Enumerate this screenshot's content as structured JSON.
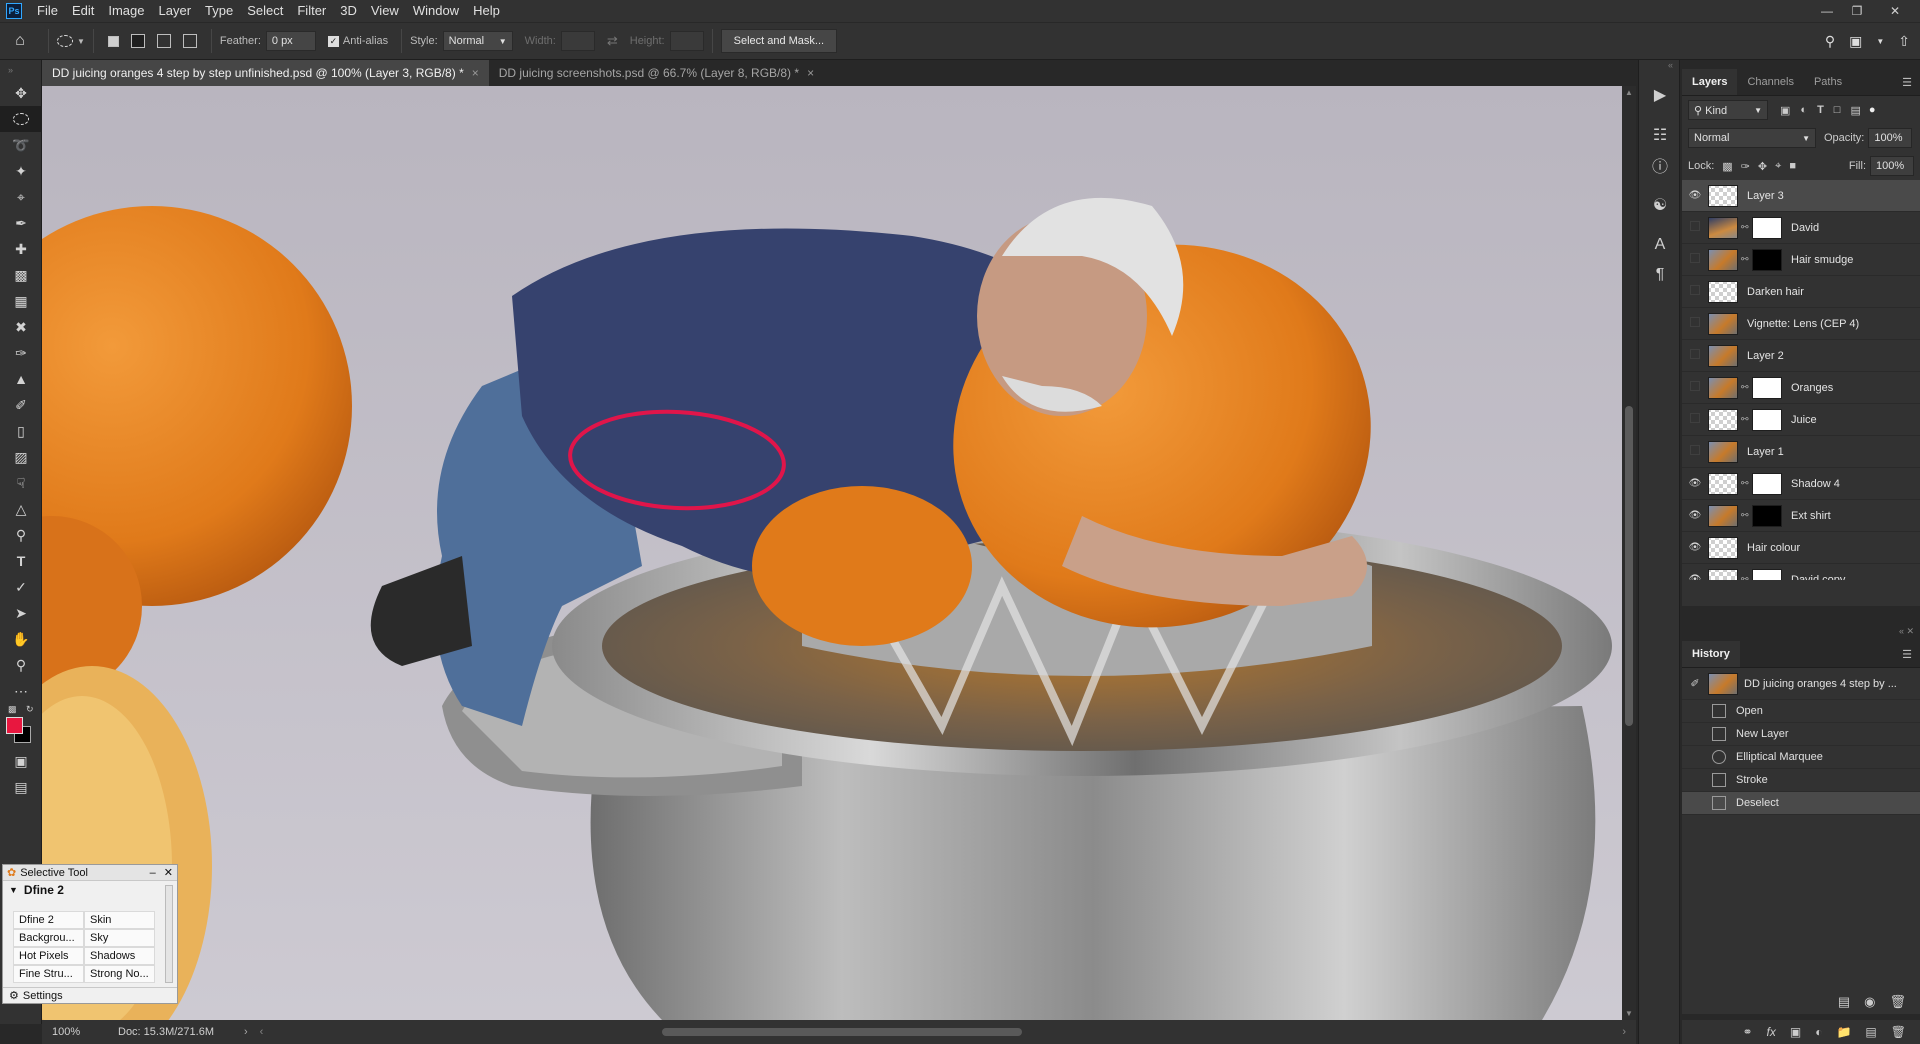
{
  "app": {
    "logo": "Ps"
  },
  "menu": [
    "File",
    "Edit",
    "Image",
    "Layer",
    "Type",
    "Select",
    "Filter",
    "3D",
    "View",
    "Window",
    "Help"
  ],
  "options": {
    "feather_label": "Feather:",
    "feather_value": "0 px",
    "antialias_label": "Anti-alias",
    "antialias_checked": true,
    "style_label": "Style:",
    "style_value": "Normal",
    "width_label": "Width:",
    "height_label": "Height:",
    "select_mask_label": "Select and Mask..."
  },
  "tabs": [
    {
      "label": "DD juicing oranges 4 step by step unfinished.psd @ 100% (Layer 3, RGB/8) *",
      "active": true
    },
    {
      "label": "DD juicing screenshots.psd @ 66.7% (Layer 8, RGB/8) *",
      "active": false
    }
  ],
  "status": {
    "zoom": "100%",
    "doc": "Doc: 15.3M/271.6M"
  },
  "layers_panel": {
    "tabs": [
      "Layers",
      "Channels",
      "Paths"
    ],
    "filter_kind": "Kind",
    "blend_mode": "Normal",
    "opacity_label": "Opacity:",
    "opacity_value": "100%",
    "lock_label": "Lock:",
    "fill_label": "Fill:",
    "fill_value": "100%",
    "layers": [
      {
        "name": "Layer 3",
        "visible": true,
        "thumb": "checker",
        "mask": "",
        "selected": true
      },
      {
        "name": "David",
        "visible": false,
        "thumb": "photo2",
        "mask": "white",
        "selected": false
      },
      {
        "name": "Hair smudge",
        "visible": false,
        "thumb": "photo",
        "mask": "black",
        "selected": false
      },
      {
        "name": "Darken hair",
        "visible": false,
        "thumb": "checker",
        "mask": "",
        "selected": false
      },
      {
        "name": "Vignette: Lens (CEP 4)",
        "visible": false,
        "thumb": "photo",
        "mask": "",
        "selected": false
      },
      {
        "name": "Layer 2",
        "visible": false,
        "thumb": "photo",
        "mask": "",
        "selected": false
      },
      {
        "name": "Oranges",
        "visible": false,
        "thumb": "photo",
        "mask": "white",
        "selected": false
      },
      {
        "name": "Juice",
        "visible": false,
        "thumb": "checker",
        "mask": "white",
        "selected": false
      },
      {
        "name": "Layer 1",
        "visible": false,
        "thumb": "photo",
        "mask": "",
        "selected": false
      },
      {
        "name": "Shadow 4",
        "visible": true,
        "thumb": "checker",
        "mask": "white",
        "selected": false
      },
      {
        "name": "Ext shirt",
        "visible": true,
        "thumb": "photo",
        "mask": "black",
        "selected": false
      },
      {
        "name": "Hair colour",
        "visible": true,
        "thumb": "checker",
        "mask": "",
        "selected": false
      },
      {
        "name": "David copy",
        "visible": true,
        "thumb": "checker",
        "mask": "white",
        "selected": false
      }
    ]
  },
  "history_panel": {
    "title": "History",
    "snapshot": "DD juicing oranges 4 step by ...",
    "items": [
      {
        "name": "Open",
        "selected": false
      },
      {
        "name": "New Layer",
        "selected": false
      },
      {
        "name": "Elliptical Marquee",
        "selected": false
      },
      {
        "name": "Stroke",
        "selected": false
      },
      {
        "name": "Deselect",
        "selected": true
      }
    ]
  },
  "dfine": {
    "title": "Selective Tool",
    "plugin": "Dfine 2",
    "grid": [
      [
        "Dfine 2",
        "Skin"
      ],
      [
        "Backgrou...",
        "Sky"
      ],
      [
        "Hot Pixels",
        "Shadows"
      ],
      [
        "Fine Stru...",
        "Strong No..."
      ]
    ],
    "settings": "Settings"
  },
  "colors": {
    "foreground": "#e8173f",
    "background": "#000000",
    "ellipse_stroke": "#e0154a"
  }
}
